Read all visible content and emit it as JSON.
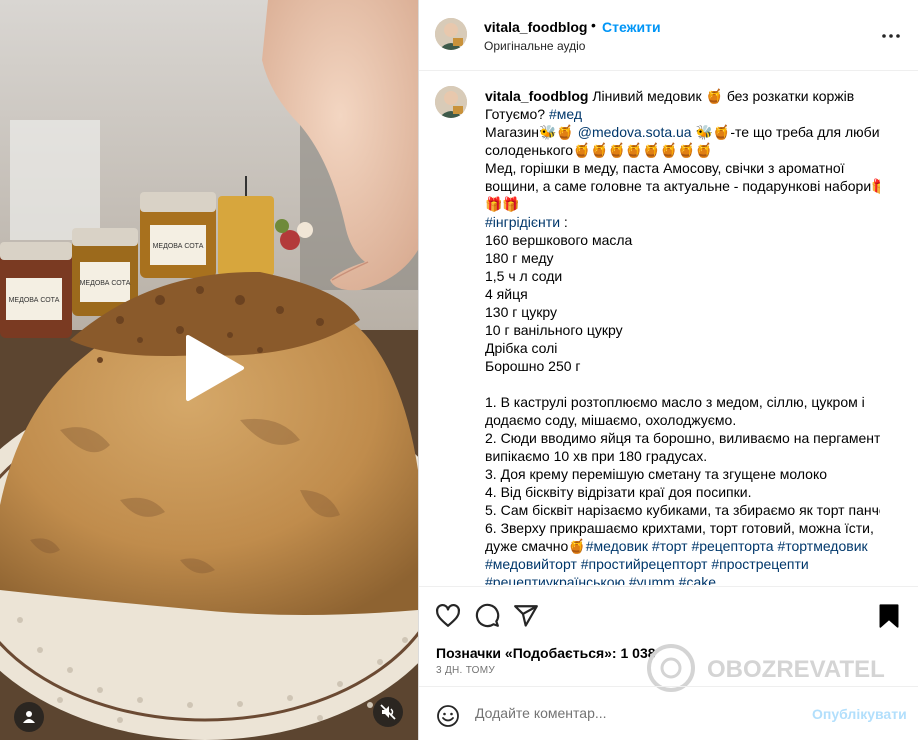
{
  "header": {
    "username": "vitala_foodblog",
    "separator": "•",
    "follow_label": "Стежити",
    "audio_label": "Оригінальне аудіо",
    "more_icon": "more-horizontal-icon"
  },
  "caption": {
    "username": "vitala_foodblog",
    "lines": [
      {
        "text": " Лінивий медовик 🍯 без розкатки коржів"
      },
      {
        "text": "Готуємо? ",
        "tag": "#мед"
      },
      {
        "text": "Магазин🐝🍯 ",
        "tag": "@medova.sota.ua",
        "after": " 🐝🍯-те що треба для любителів"
      },
      {
        "text": "солоденького🍯🍯🍯🍯🍯🍯🍯🍯"
      },
      {
        "text": "Мед, горішки в меду, паста Амосову, свічки з ароматної"
      },
      {
        "text": "вощини, а саме головне та актуальне - подарункові набори🎁"
      },
      {
        "text": "🎁🎁"
      },
      {
        "text": "",
        "tag": "#інгрідієнти",
        "after": " :"
      },
      {
        "text": "160 вершкового масла"
      },
      {
        "text": "180 г меду"
      },
      {
        "text": "1,5 ч л соди"
      },
      {
        "text": "4 яйця"
      },
      {
        "text": "130 г цукру"
      },
      {
        "text": "10 г ванільного цукру"
      },
      {
        "text": "Дрібка солі"
      },
      {
        "text": "Борошно 250 г"
      },
      {
        "text": ""
      },
      {
        "text": "1. В каструлі розтоплюємо масло з медом, сіллю, цукром і"
      },
      {
        "text": "додаємо соду, мішаємо, охолоджуємо."
      },
      {
        "text": "2. Сюди вводимо яйця та борошно, виливаємо на пергамент,"
      },
      {
        "text": "випікаємо 10 хв при 180 градусах."
      },
      {
        "text": "3. Доя крему перемішую сметану та згущене молоко"
      },
      {
        "text": "4. Від бісквіту відрізати краї доя посипки."
      },
      {
        "text": "5. Сам бісквіт нарізаємо кубиками, та збираємо як торт панчо."
      },
      {
        "text": "6. Зверху прикрашаємо крихтами, торт готовий, можна їсти,"
      },
      {
        "text": "дуже смачно🍯",
        "tag": "#медовик #торт #рецепторта #тортмедовик"
      },
      {
        "text": "",
        "tag": "#медовийторт #простийрецепторт #прострецепти"
      },
      {
        "text": "",
        "tag": "#рецептиукраїнською #yumm #cake"
      }
    ]
  },
  "actions": {
    "likes_label": "Позначки «Подобається»: 1 038",
    "time_label": "3 ДН. ТОМУ",
    "watermark_text": "OBOZREVATEL"
  },
  "comment": {
    "placeholder": "Додайте коментар...",
    "publish_label": "Опублікувати"
  },
  "media": {
    "jar_label_1": "МЕДОВА СОТА",
    "jar_label_2": "МЕДОВА СОТА",
    "jar_label_3": "МЕДОВА СОТА"
  },
  "colors": {
    "accent": "#0095f6",
    "link": "#00376b",
    "publish_disabled": "#b2dffc",
    "cream": "#c99a55"
  }
}
